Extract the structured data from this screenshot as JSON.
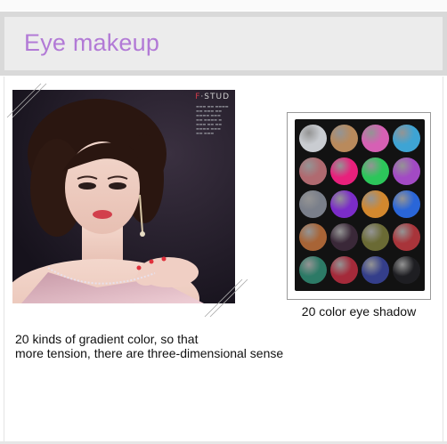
{
  "header": {
    "title": "Eye makeup"
  },
  "photo": {
    "logo_mark": "F",
    "logo_rest": "·STUD"
  },
  "palette": {
    "caption": "20 color eye shadow",
    "colors": [
      "#c9ccd1",
      "#b98a5c",
      "#d660b4",
      "#3ea4d4",
      "#b06a70",
      "#e8207c",
      "#2cc65a",
      "#a24ac4",
      "#7a7f8a",
      "#7b2cc8",
      "#d2882e",
      "#2a66d8",
      "#a86436",
      "#3a2838",
      "#6a6a34",
      "#a8343a",
      "#2c7a66",
      "#a42a3a",
      "#343e8a",
      "#1e1e22"
    ]
  },
  "description": {
    "line1": "20 kinds of gradient color, so that",
    "line2": "more tension, there are three-dimensional sense"
  }
}
